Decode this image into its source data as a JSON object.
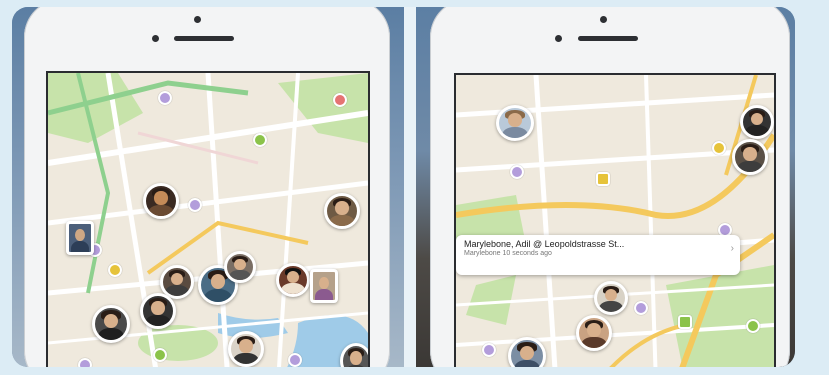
{
  "callout": {
    "title": "Marylebone, Adil @ Leopoldstrasse St...",
    "subtitle": "Marylebone 10 seconds ago"
  },
  "colors": {
    "road_major": "#f4c95d",
    "road_minor": "#ffffff",
    "park": "#b9dc9a",
    "water": "#9fcbe8",
    "poi_purple": "#b39ddb",
    "poi_green": "#8bc34a",
    "poi_yellow": "#e6c33a"
  },
  "icons": {
    "chevron": "chevron-right-icon"
  }
}
